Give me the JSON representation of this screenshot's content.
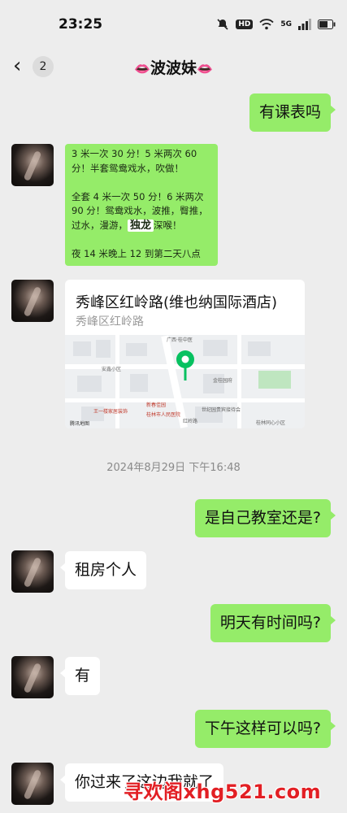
{
  "status_bar": {
    "time": "23:25",
    "hd": "HD",
    "network": "5G"
  },
  "header": {
    "back_count": "2",
    "title": "波波妹",
    "title_decoration": "👄"
  },
  "messages": {
    "m1": "有课表吗",
    "rates": {
      "line1": "3 米一次 30 分！5 米两次 60 分！半套鸳鸯戏水，吹做！",
      "line2a": "全套 4 米一次 50 分！6 米两次 90 分！鸳鸯戏水，波推，臀推，过水，漫游，",
      "line2_highlight": "独龙",
      "line2b": "深喉！",
      "line3": "夜 14 米晚上 12 到第二天八点"
    },
    "location": {
      "name": "秀峰区红岭路(维也纳国际酒店)",
      "address": "秀峰区红岭路"
    },
    "timestamp": "2024年8月29日 下午16:48",
    "m2": "是自己教室还是?",
    "m3": "租房个人",
    "m4": "明天有时间吗?",
    "m5": "有",
    "m6": "下午这样可以吗?",
    "m7": "你过来了这边我就了"
  },
  "map_labels": [
    "广西·桂中医",
    "安鑫小区",
    "金桂园府",
    "世纪园贵宾接待会",
    "桂林市人民医院",
    "腾讯地图",
    "红岭路",
    "新春佳园",
    "桂林同心小区",
    "王一楼家居装饰"
  ],
  "watermark": "寻欢阁xhg521.com"
}
